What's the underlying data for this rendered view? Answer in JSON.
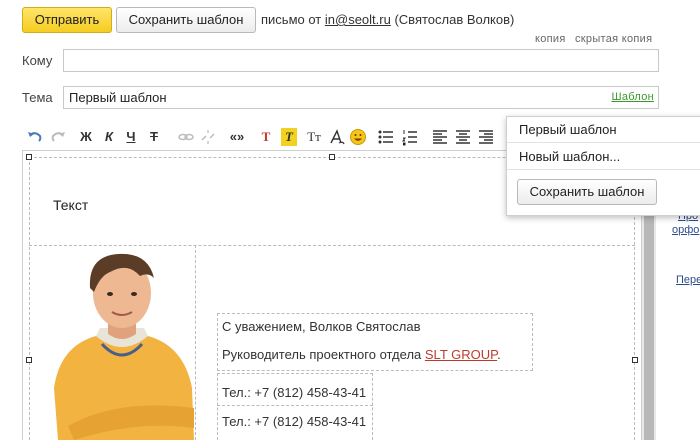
{
  "toolbar": {
    "send_label": "Отправить",
    "save_template_label": "Сохранить шаблон",
    "from_prefix": "письмо от",
    "from_email": "in@seolt.ru",
    "from_name": "(Святослав Волков)"
  },
  "recipients": {
    "cc_label": "копия",
    "bcc_label": "скрытая копия",
    "to_label": "Кому",
    "to_value": ""
  },
  "subject": {
    "label": "Тема",
    "value": "Первый шаблон",
    "template_link": "Шаблон"
  },
  "format_toolbar": {
    "bold": "Ж",
    "italic": "К",
    "underline": "Ч",
    "strike": "Т",
    "quotes": "«»",
    "text_color": "Т",
    "bg_color": "Т",
    "font_size": "Тт"
  },
  "editor": {
    "body_text": "Текст",
    "signature": {
      "greeting": "С уважением, Волков Святослав",
      "position": "Руководитель проектного отдела",
      "company_link": "SLT GROUP",
      "position_end": ".",
      "phone_1": "Тел.: +7 (812) 458-43-41",
      "phone_2": "Тел.: +7 (812) 458-43-41"
    }
  },
  "template_menu": {
    "items": [
      "Первый шаблон",
      "Новый шаблон..."
    ],
    "save_button": "Сохранить шаблон"
  },
  "side_links": {
    "link_1a": "Про",
    "link_1b": "орфо",
    "link_2": "Пере"
  },
  "colors": {
    "accent_yellow": "#f5cc1f",
    "link_green": "#3a9a2c",
    "link_red": "#c0392b"
  }
}
